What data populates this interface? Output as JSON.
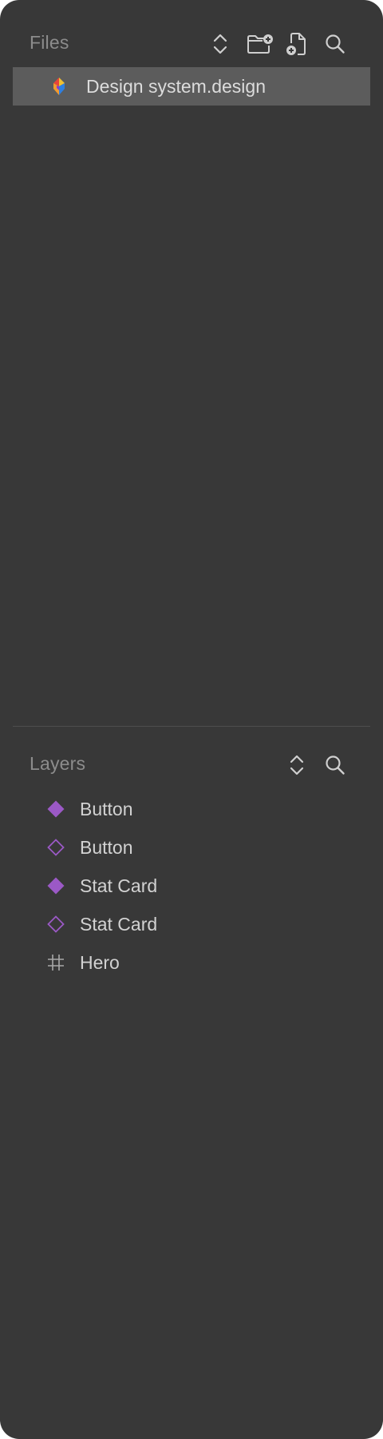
{
  "files": {
    "title": "Files",
    "tools": [
      {
        "icon": "sort-chevrons-icon",
        "label": "Sort"
      },
      {
        "icon": "new-folder-icon",
        "label": "New folder"
      },
      {
        "icon": "new-file-icon",
        "label": "New file"
      },
      {
        "icon": "search-icon",
        "label": "Search"
      }
    ],
    "items": [
      {
        "name": "Design system.design",
        "icon": "design-file-icon",
        "selected": true
      }
    ]
  },
  "layers": {
    "title": "Layers",
    "tools": [
      {
        "icon": "sort-chevrons-icon",
        "label": "Sort"
      },
      {
        "icon": "search-icon",
        "label": "Search"
      }
    ],
    "items": [
      {
        "name": "Button",
        "icon": "component-main-icon"
      },
      {
        "name": "Button",
        "icon": "component-instance-icon"
      },
      {
        "name": "Stat Card",
        "icon": "component-main-icon"
      },
      {
        "name": "Stat Card",
        "icon": "component-instance-icon"
      },
      {
        "name": "Hero",
        "icon": "frame-icon"
      }
    ]
  },
  "colors": {
    "panel_bg": "#383838",
    "selected_row": "#5c5c5c",
    "component_purple": "#9b59c6",
    "header_text": "#8c8c8c",
    "item_text": "#d2d2d2"
  }
}
